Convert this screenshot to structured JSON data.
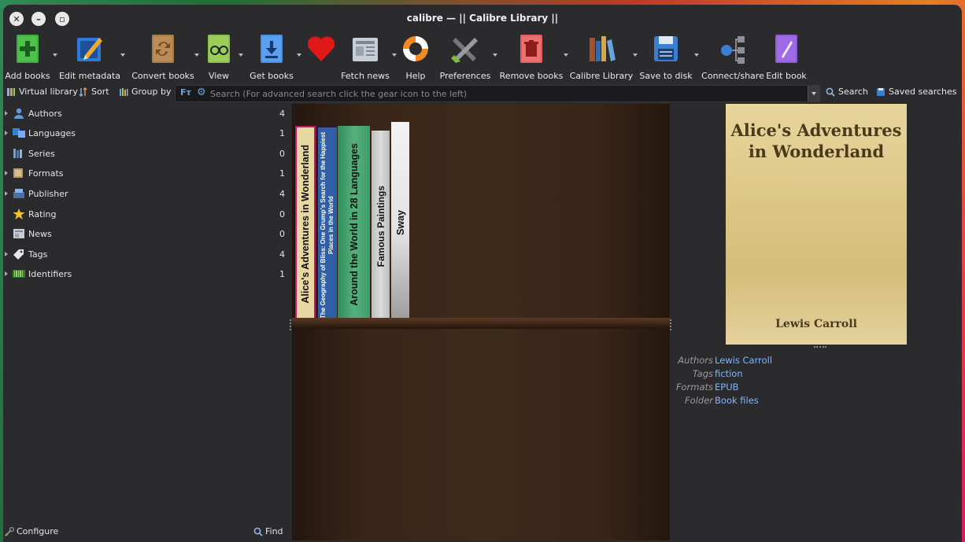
{
  "window": {
    "title": "calibre — || Calibre Library ||"
  },
  "toolbar": {
    "items": [
      {
        "label": "Add books",
        "icon": "add-book-icon"
      },
      {
        "label": "Edit metadata",
        "icon": "edit-metadata-icon"
      },
      {
        "label": "Convert books",
        "icon": "convert-icon"
      },
      {
        "label": "View",
        "icon": "view-icon"
      },
      {
        "label": "Get books",
        "icon": "get-books-icon"
      },
      {
        "label": "",
        "icon": "heart-icon"
      },
      {
        "label": "Fetch news",
        "icon": "news-icon"
      },
      {
        "label": "Help",
        "icon": "lifebuoy-icon"
      },
      {
        "label": "Preferences",
        "icon": "preferences-icon"
      },
      {
        "label": "Remove books",
        "icon": "trash-icon"
      },
      {
        "label": "Calibre Library",
        "icon": "library-icon"
      },
      {
        "label": "Save to disk",
        "icon": "save-icon"
      },
      {
        "label": "Connect/share",
        "icon": "network-icon"
      },
      {
        "label": "Edit book",
        "icon": "edit-book-icon"
      }
    ]
  },
  "bar2": {
    "virtual_library": "Virtual library",
    "sort": "Sort",
    "group_by": "Group by",
    "search_placeholder": "Search (For advanced search click the gear icon to the left)",
    "search_button": "Search",
    "saved_searches": "Saved searches"
  },
  "tag_browser": {
    "items": [
      {
        "label": "Authors",
        "count": "4",
        "expandable": true,
        "icon": "person-icon"
      },
      {
        "label": "Languages",
        "count": "1",
        "expandable": true,
        "icon": "languages-icon"
      },
      {
        "label": "Series",
        "count": "0",
        "expandable": false,
        "icon": "series-icon"
      },
      {
        "label": "Formats",
        "count": "1",
        "expandable": true,
        "icon": "formats-icon"
      },
      {
        "label": "Publisher",
        "count": "4",
        "expandable": true,
        "icon": "publisher-icon"
      },
      {
        "label": "Rating",
        "count": "0",
        "expandable": false,
        "icon": "star-icon"
      },
      {
        "label": "News",
        "count": "0",
        "expandable": false,
        "icon": "news-icon"
      },
      {
        "label": "Tags",
        "count": "4",
        "expandable": true,
        "icon": "tag-icon"
      },
      {
        "label": "Identifiers",
        "count": "1",
        "expandable": true,
        "icon": "barcode-icon"
      }
    ],
    "configure": "Configure",
    "find": "Find"
  },
  "bookshelf": {
    "books": [
      {
        "title": "Alice's Adventures in Wonderland",
        "color": "#e9d7a3",
        "selected": true
      },
      {
        "title": "The Geography of Bliss: One Grump's Search for the Happiest Places in the World",
        "color": "#2f5fa6"
      },
      {
        "title": "Around the World in 28 Languages",
        "color": "#3f9e6a"
      },
      {
        "title": "Famous Paintings",
        "color": "#cfcfcf"
      },
      {
        "title": "Sway",
        "color": "#e6e6e6"
      }
    ]
  },
  "details": {
    "cover_title": "Alice's Adventures in Wonderland",
    "cover_author": "Lewis Carroll",
    "fields": [
      {
        "key": "Authors",
        "value": "Lewis Carroll"
      },
      {
        "key": "Tags",
        "value": "fiction"
      },
      {
        "key": "Formats",
        "value": "EPUB"
      },
      {
        "key": "Folder",
        "value": "Book files"
      }
    ]
  }
}
